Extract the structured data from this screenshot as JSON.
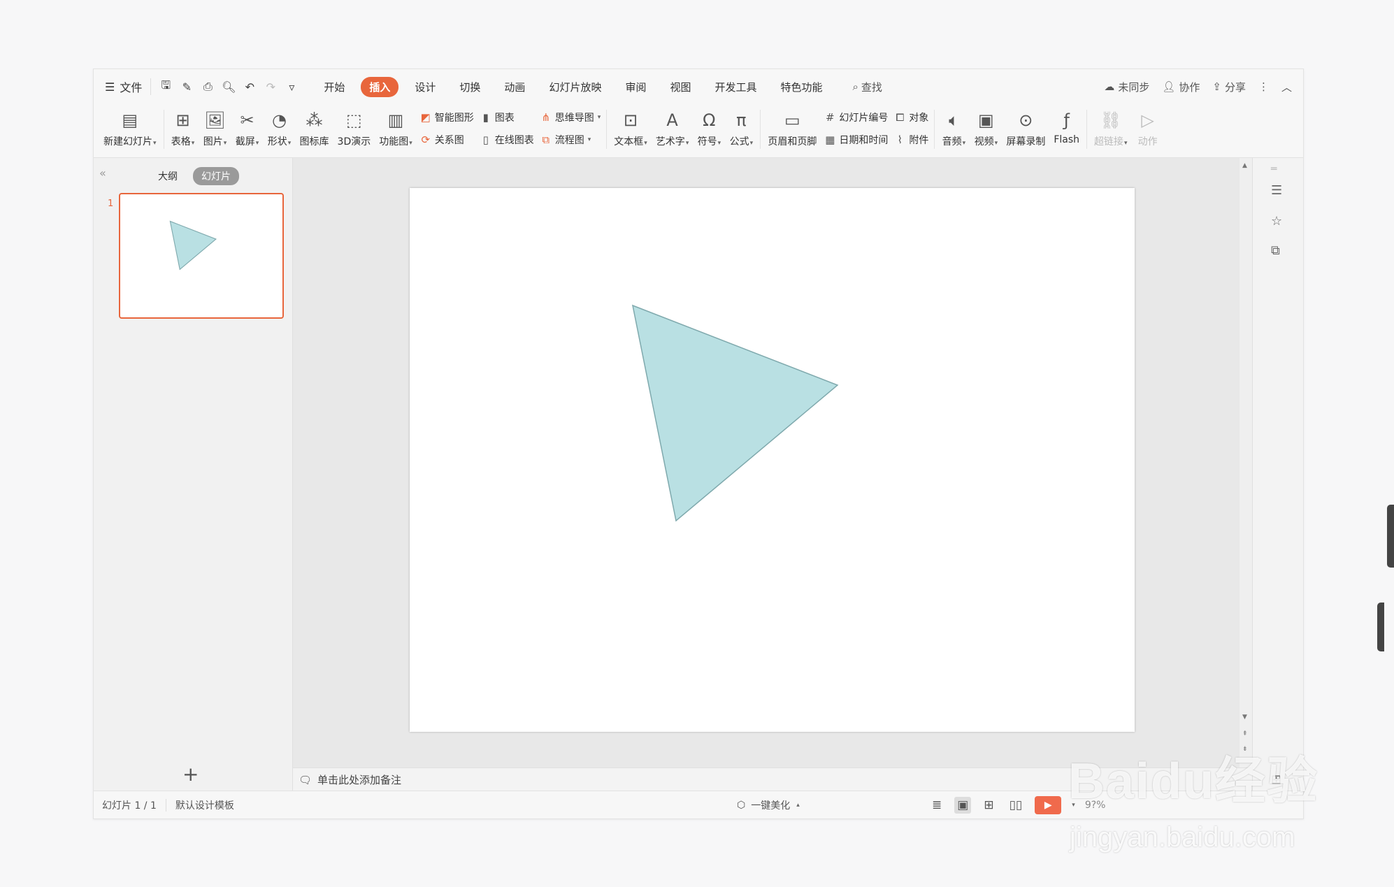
{
  "menubar": {
    "file": "文件",
    "tabs": [
      "开始",
      "插入",
      "设计",
      "切换",
      "动画",
      "幻灯片放映",
      "审阅",
      "视图",
      "开发工具",
      "特色功能"
    ],
    "active_tab": "插入",
    "search": "查找",
    "right": {
      "sync": "未同步",
      "collab": "协作",
      "share": "分享"
    }
  },
  "ribbon": {
    "new_slide": "新建幻灯片",
    "table": "表格",
    "picture": "图片",
    "screenshot": "截屏",
    "shape": "形状",
    "icon_lib": "图标库",
    "demo3d": "3D演示",
    "func_chart": "功能图",
    "smart_shape": "智能图形",
    "chart": "图表",
    "relation_chart": "关系图",
    "online_chart": "在线图表",
    "mind_map": "思维导图",
    "flow_chart": "流程图",
    "text_box": "文本框",
    "word_art": "艺术字",
    "symbol": "符号",
    "formula": "公式",
    "header_footer": "页眉和页脚",
    "slide_number": "幻灯片编号",
    "object": "对象",
    "date_time": "日期和时间",
    "attachment": "附件",
    "audio": "音频",
    "video": "视频",
    "screen_record": "屏幕录制",
    "flash": "Flash",
    "hyperlink": "超链接",
    "action": "动作"
  },
  "left_panel": {
    "tabs": [
      "大纲",
      "幻灯片"
    ],
    "active_tab": "幻灯片",
    "slide_number": "1"
  },
  "notes_placeholder": "单击此处添加备注",
  "status": {
    "slide_info": "幻灯片 1 / 1",
    "template": "默认设计模板",
    "beautify": "一键美化",
    "zoom": "9?%"
  },
  "slide": {
    "shape": "triangle",
    "fill_color": "#b9e0e3",
    "stroke_color": "#7fa9ad"
  },
  "watermark": {
    "brand": "Baidu经验",
    "url": "jingyan.baidu.com"
  },
  "colors": {
    "accent": "#e8663c",
    "play": "#f06a4c"
  }
}
